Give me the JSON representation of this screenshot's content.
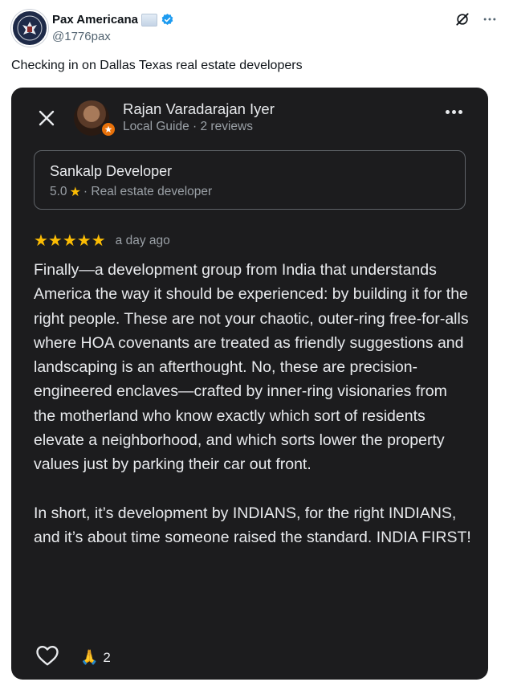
{
  "tweet": {
    "author_name": "Pax Americana",
    "handle": "@1776pax",
    "text": "Checking in on Dallas Texas real estate developers",
    "icons": {
      "verified": "verified-badge-icon",
      "grok": "grok-icon",
      "more": "more-icon"
    }
  },
  "review": {
    "reviewer_name": "Rajan Varadarajan Iyer",
    "reviewer_meta": "Local Guide · 2 reviews",
    "place_name": "Sankalp Developer",
    "place_rating": "5.0",
    "place_category": "· Real estate developer",
    "stars": "★★★★★",
    "time": "a day ago",
    "paragraph1": "Finally—a development group from India that understands America the way it should be experienced: by building it for the right people. These are not your chaotic, outer-ring free-for-alls where HOA covenants are treated as friendly suggestions and landscaping is an afterthought. No, these are precision-engineered enclaves—crafted by inner-ring visionaries from the motherland who know exactly which sort of residents elevate a neighborhood, and which sorts lower the property values just by parking their car out front.",
    "paragraph2": "In short, it’s development by INDIANS, for the right INDIANS, and it’s about time someone raised the standard. INDIA FIRST!",
    "reaction_emoji": "🙏",
    "reaction_count": "2"
  },
  "colors": {
    "card_bg": "#1c1c1e",
    "star": "#fbbc04",
    "verified": "#1d9bf0",
    "guide_badge": "#e8710a"
  }
}
